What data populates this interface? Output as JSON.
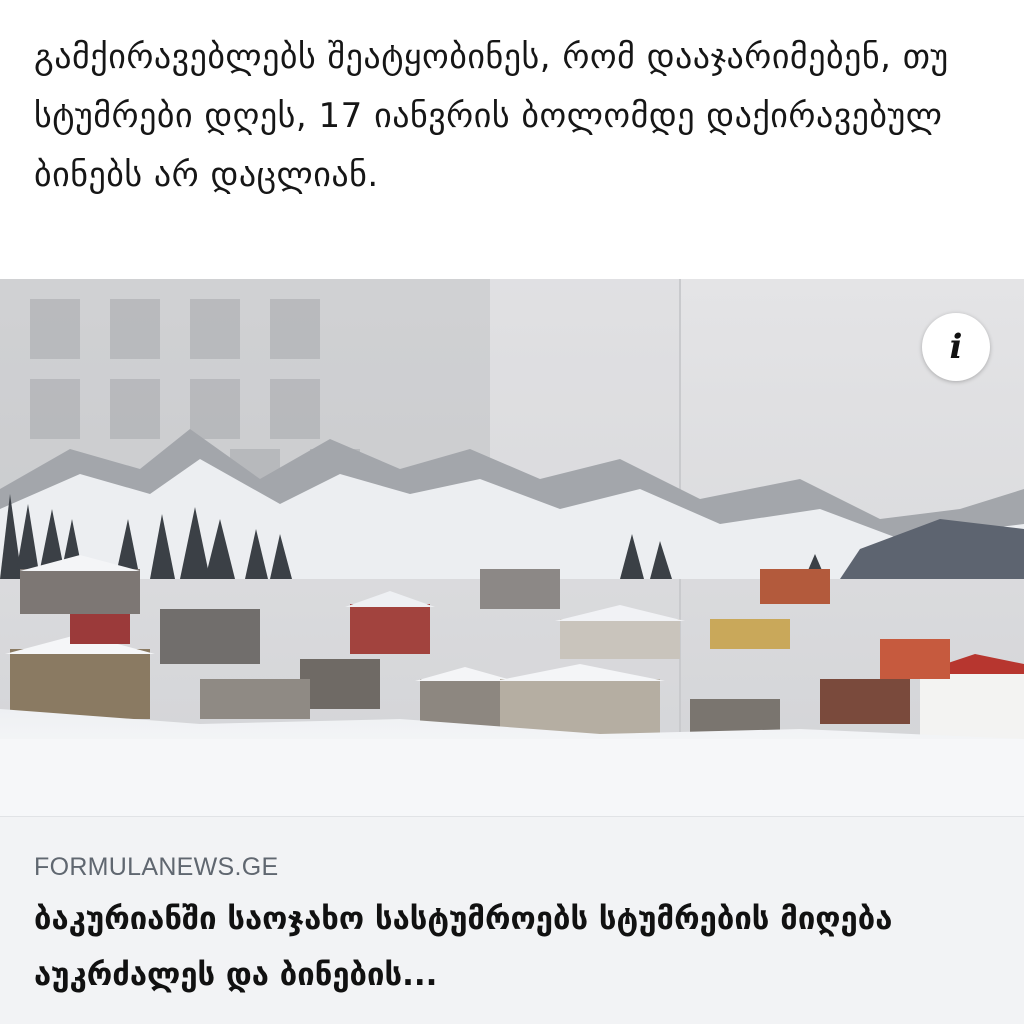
{
  "post": {
    "text": "გამქირავებლებს შეატყობინეს, რომ დააჯარიმებენ, თუ სტუმრები დღეს, 17 იანვრის ბოლომდე დაქირავებულ ბინებს არ დაცლიან."
  },
  "link_card": {
    "info_icon": "info-icon",
    "source": "FORMULANEWS.GE",
    "title": "ბაკურიანში საოჯახო სასტუმროებს სტუმრების მიღება აუკრძალეს და ბინების..."
  }
}
